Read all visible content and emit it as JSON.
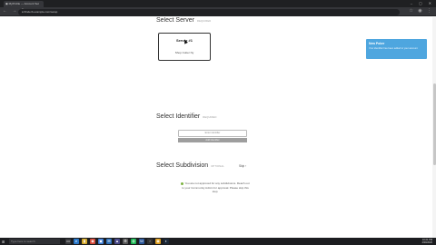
{
  "browser": {
    "tab_title": "▣ MyProfile — Account Set",
    "window_controls": "– ◻ ✕",
    "nav_icons": "← → ↻",
    "url": "● lfinderb.example.com/setup",
    "addr_right_icons": "☆ ◉ ⋮"
  },
  "sections": {
    "server": {
      "title": "Select Server",
      "required": "REQUIRED"
    },
    "identifier": {
      "title": "Select Identifier",
      "required": "REQUIRED"
    },
    "subdivision": {
      "title": "Select Subdivision",
      "required": "OPTIONAL"
    }
  },
  "server_card": {
    "name": "Server #1",
    "subtitle": "Shop Cutter Ny"
  },
  "identifier": {
    "placeholder": "Enter identifier",
    "button_label": "Add Identifier"
  },
  "subdivision": {
    "skip_label": "Skip ›",
    "notice": "You are not approved for any subdivisions. Reach out to your Community Admin for approval. Please skip this step."
  },
  "toast": {
    "title": "New Poker",
    "message": "Your identifier has been added to your account"
  },
  "taskbar": {
    "start": "⊞",
    "search_placeholder": "Type here to search",
    "icons": [
      {
        "name": "task-view-icon",
        "glyph": "▭",
        "color": "#3a3b3f"
      },
      {
        "name": "edge-icon",
        "glyph": "e",
        "color": "#2a78c8"
      },
      {
        "name": "explorer-icon",
        "glyph": "▮",
        "color": "#d4a92a"
      },
      {
        "name": "chrome-icon",
        "glyph": "◉",
        "color": "#d64a3a"
      },
      {
        "name": "store-icon",
        "glyph": "▣",
        "color": "#3a7bd5"
      },
      {
        "name": "mail-icon",
        "glyph": "✉",
        "color": "#2d6fb9"
      },
      {
        "name": "photos-icon",
        "glyph": "▲",
        "color": "#4a4a8a"
      },
      {
        "name": "settings-icon",
        "glyph": "⚙",
        "color": "#5a5a5a"
      },
      {
        "name": "spotify-icon",
        "glyph": "◍",
        "color": "#1db954"
      },
      {
        "name": "word-icon",
        "glyph": "W",
        "color": "#2b579a"
      },
      {
        "name": "terminal-icon",
        "glyph": "›",
        "color": "#333333"
      },
      {
        "name": "chrome-icon-2",
        "glyph": "◉",
        "color": "#e0a020"
      },
      {
        "name": "steam-icon",
        "glyph": "◐",
        "color": "#1b2838"
      }
    ],
    "time": "10:21 PM",
    "date": "4/30/2020"
  }
}
